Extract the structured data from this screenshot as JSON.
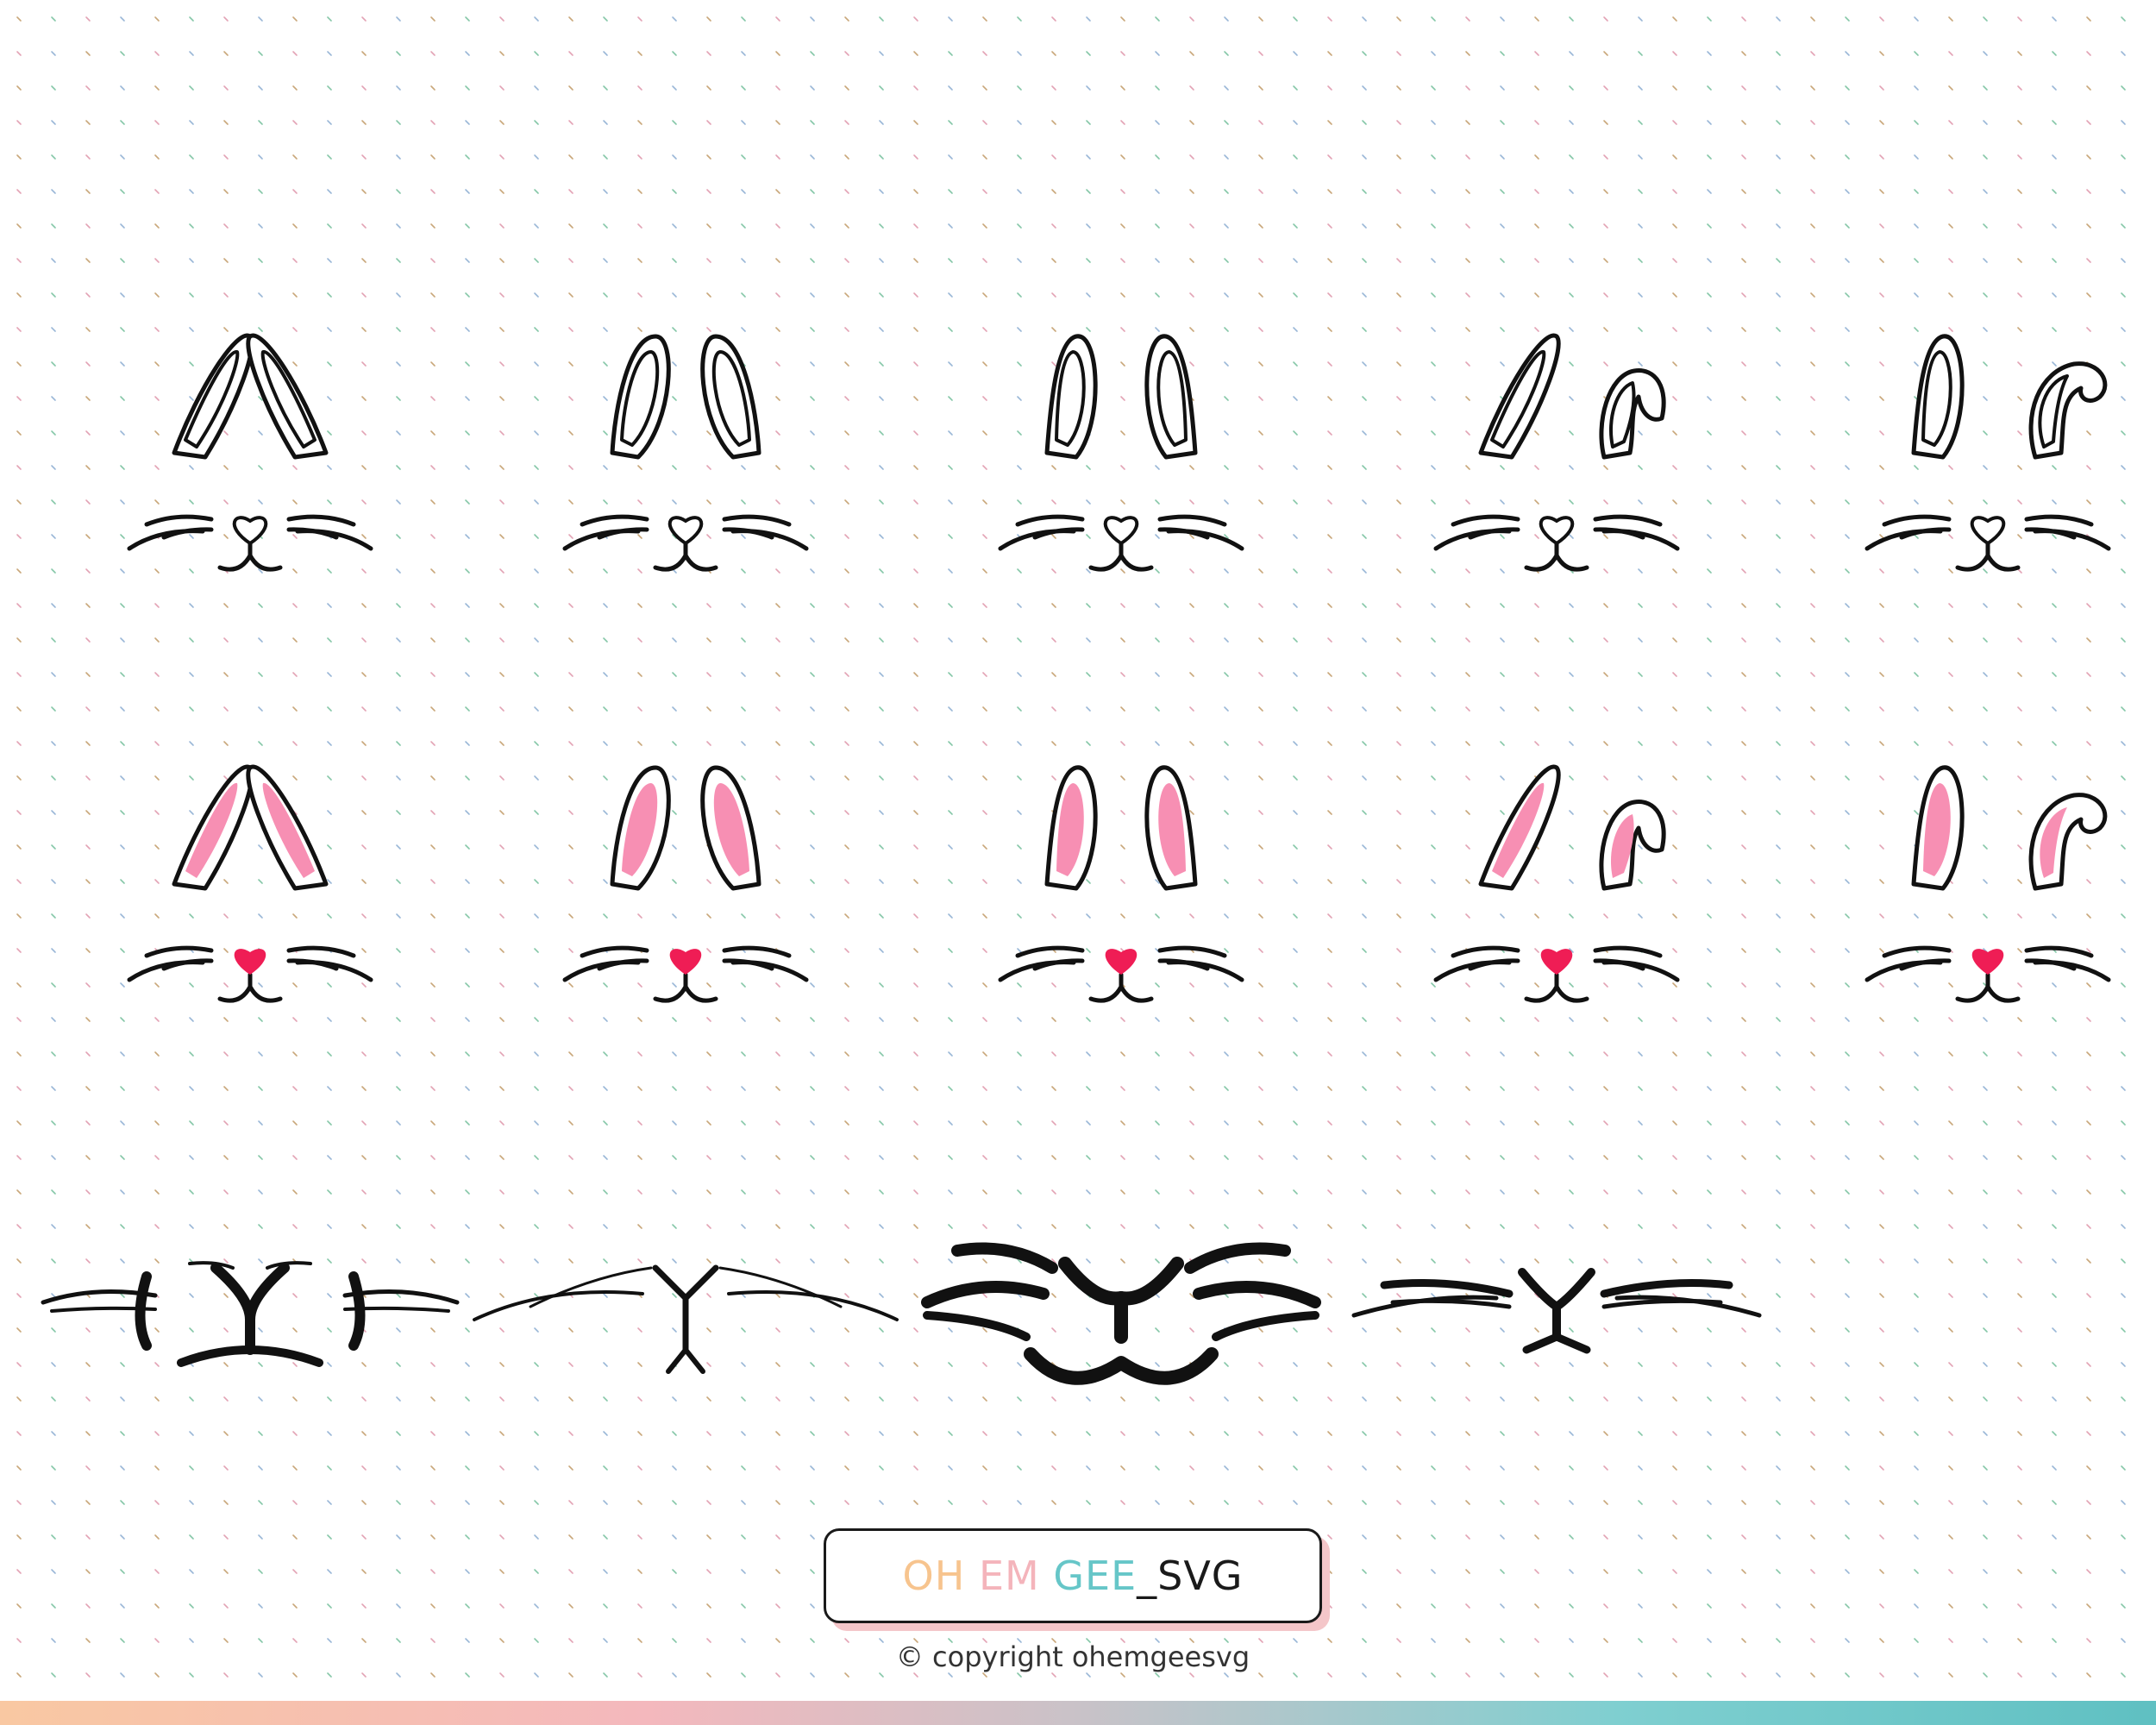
{
  "logo": {
    "oh": "OH",
    "em": "EM",
    "gee": "GEE",
    "underscore": "_",
    "svg": "SVG",
    "colors": {
      "oh": "#f7c48e",
      "em": "#f4b4bb",
      "gee": "#66c6c8",
      "svg": "#1a1a1a"
    }
  },
  "copyright": "© copyright ohemgeesvg",
  "colors": {
    "line": "#111111",
    "inner_ear": "#f78fb3",
    "nose": "#ef1d55",
    "dots": [
      "#c9a77a",
      "#86c7a8",
      "#e3a3b5",
      "#9ab7d7"
    ],
    "bar_start": "#f9c8a2",
    "bar_end": "#5fc0c2"
  },
  "designs": {
    "row1": [
      {
        "ears": "tall",
        "fill": false
      },
      {
        "ears": "oval",
        "fill": false
      },
      {
        "ears": "round-tall",
        "fill": false
      },
      {
        "ears": "one-floppy",
        "fill": false
      },
      {
        "ears": "one-curled",
        "fill": false
      }
    ],
    "row2": [
      {
        "ears": "tall",
        "fill": true
      },
      {
        "ears": "oval",
        "fill": true
      },
      {
        "ears": "round-tall",
        "fill": true
      },
      {
        "ears": "one-floppy",
        "fill": true
      },
      {
        "ears": "one-curled",
        "fill": true
      }
    ],
    "row3": [
      "bold-cheeks",
      "thin-whiskers",
      "heavy-smile",
      "sleek"
    ]
  }
}
